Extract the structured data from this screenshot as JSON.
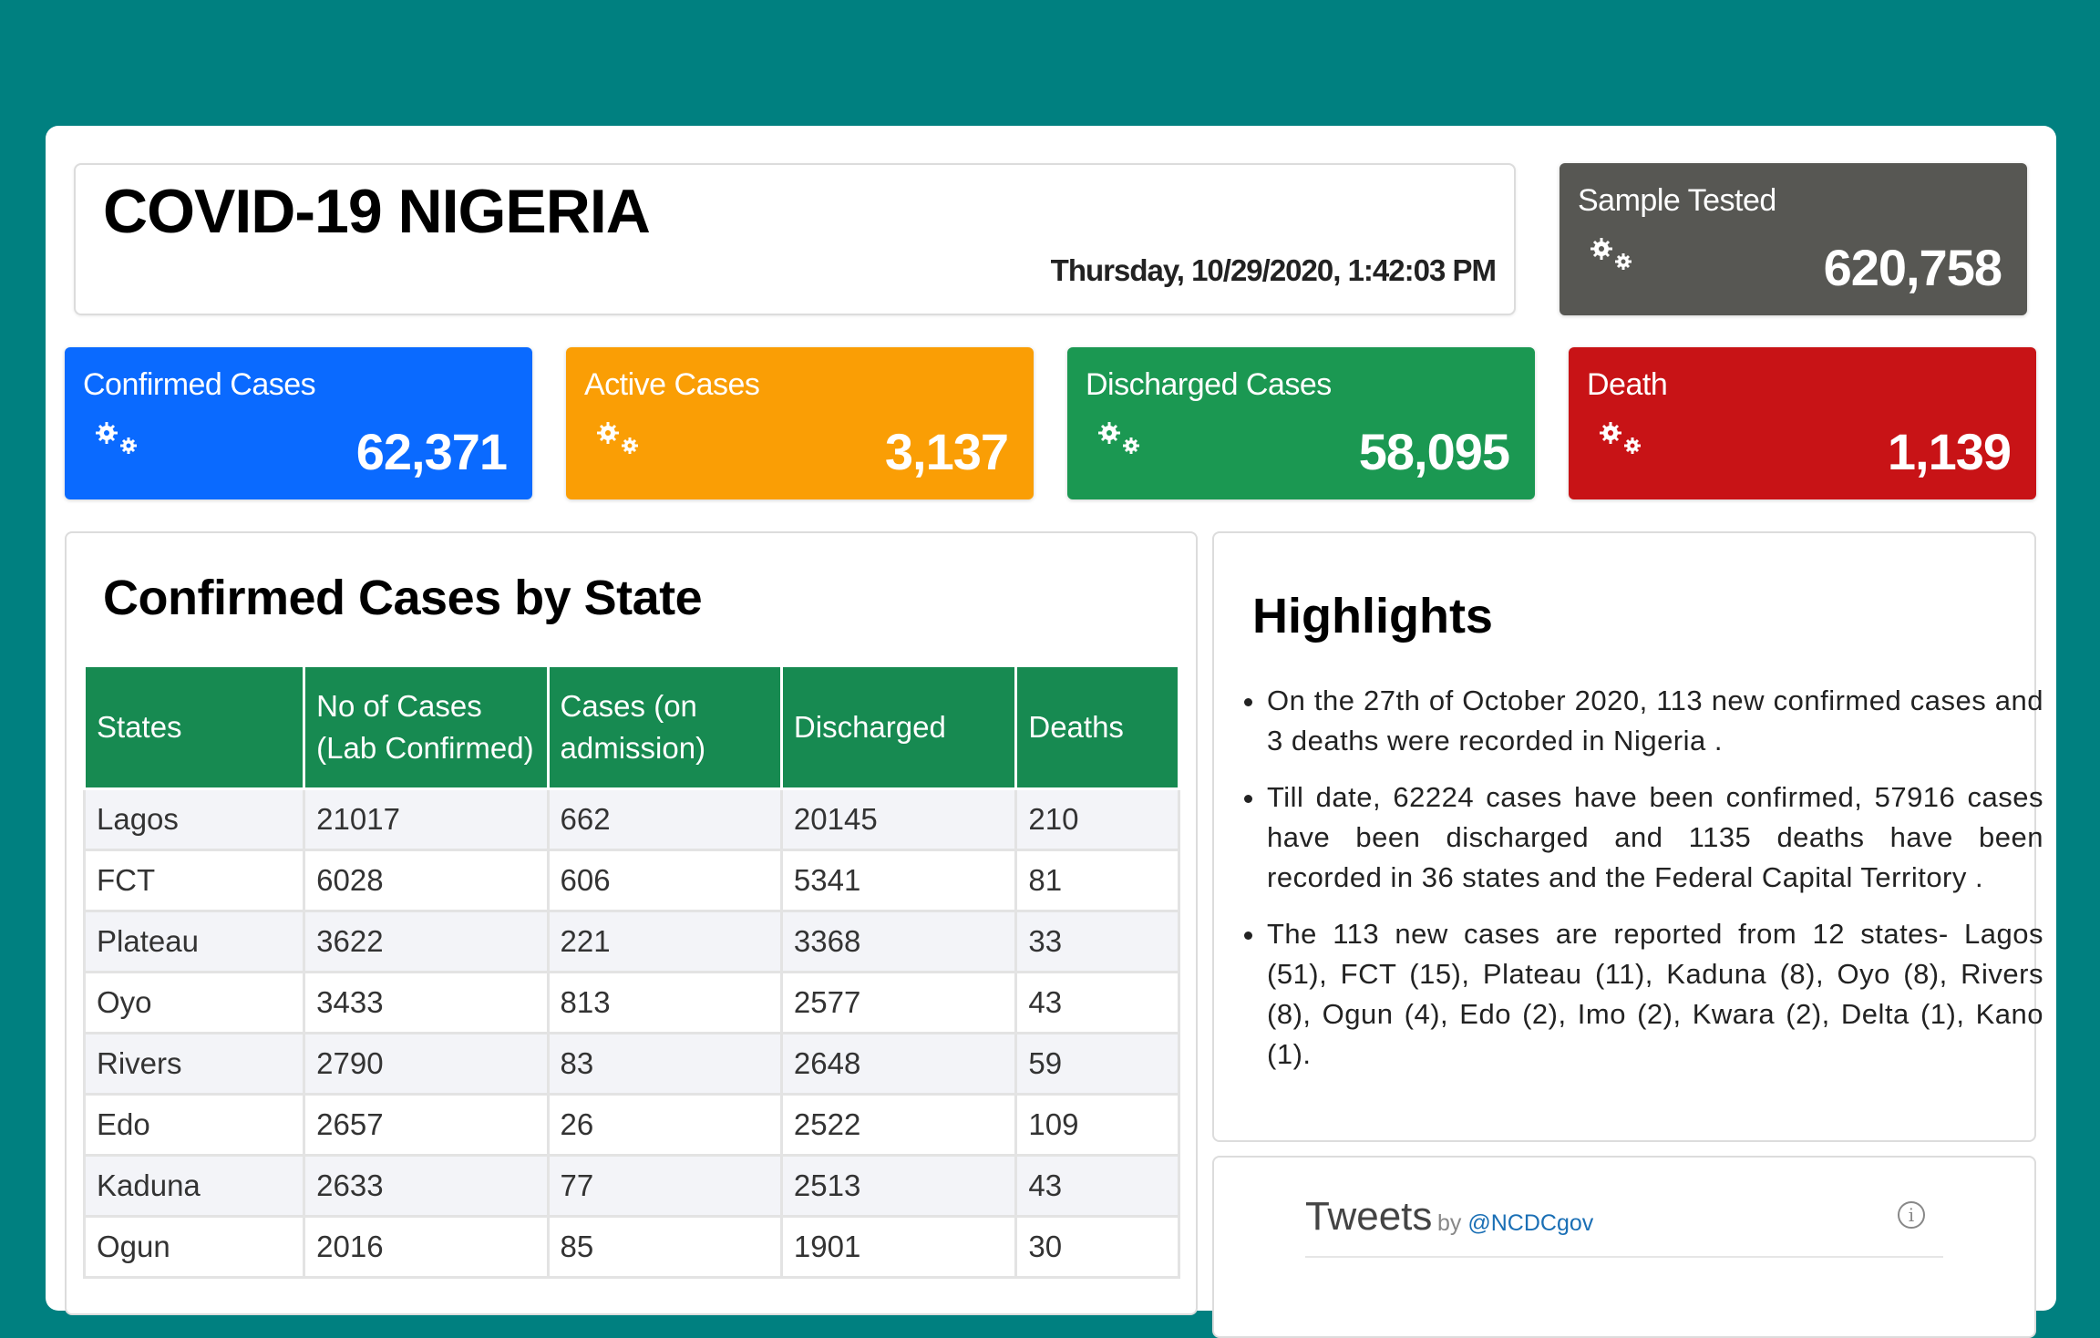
{
  "header": {
    "title": "COVID-19 NIGERIA",
    "datetime": "Thursday, 10/29/2020, 1:42:03 PM"
  },
  "stats": {
    "sample": {
      "label": "Sample Tested",
      "value": "620,758",
      "color": "#575753"
    },
    "confirmed": {
      "label": "Confirmed Cases",
      "value": "62,371",
      "color": "#0a6aff"
    },
    "active": {
      "label": "Active Cases",
      "value": "3,137",
      "color": "#fa9e05"
    },
    "discharged": {
      "label": "Discharged Cases",
      "value": "58,095",
      "color": "#1b9852"
    },
    "death": {
      "label": "Death",
      "value": "1,139",
      "color": "#c81316"
    },
    "icon": "virus-gears-icon"
  },
  "table": {
    "title": "Confirmed Cases by State",
    "headers": [
      "States",
      "No of Cases (Lab Confirmed)",
      "Cases (on admission)",
      "Discharged",
      "Deaths"
    ],
    "header_color": "#178a51",
    "rows": [
      [
        "Lagos",
        "21017",
        "662",
        "20145",
        "210"
      ],
      [
        "FCT",
        "6028",
        "606",
        "5341",
        "81"
      ],
      [
        "Plateau",
        "3622",
        "221",
        "3368",
        "33"
      ],
      [
        "Oyo",
        "3433",
        "813",
        "2577",
        "43"
      ],
      [
        "Rivers",
        "2790",
        "83",
        "2648",
        "59"
      ],
      [
        "Edo",
        "2657",
        "26",
        "2522",
        "109"
      ],
      [
        "Kaduna",
        "2633",
        "77",
        "2513",
        "43"
      ],
      [
        "Ogun",
        "2016",
        "85",
        "1901",
        "30"
      ]
    ]
  },
  "highlights": {
    "title": "Highlights",
    "items": [
      "On the 27th of October 2020, 113 new confirmed cases and 3 deaths were recorded in Nigeria .",
      "Till date, 62224 cases have been confirmed, 57916 cases have been discharged and 1135 deaths have been recorded in 36 states and the Federal Capital Territory .",
      "The 113 new cases are reported from 12 states- Lagos (51), FCT (15), Plateau (11), Kaduna (8), Oyo (8), Rivers (8), Ogun (4), Edo (2), Imo (2), Kwara (2), Delta (1), Kano (1)."
    ]
  },
  "tweets": {
    "title": "Tweets",
    "by": "by",
    "handle": "@NCDCgov",
    "info_icon": "info-icon",
    "info_glyph": "i"
  }
}
